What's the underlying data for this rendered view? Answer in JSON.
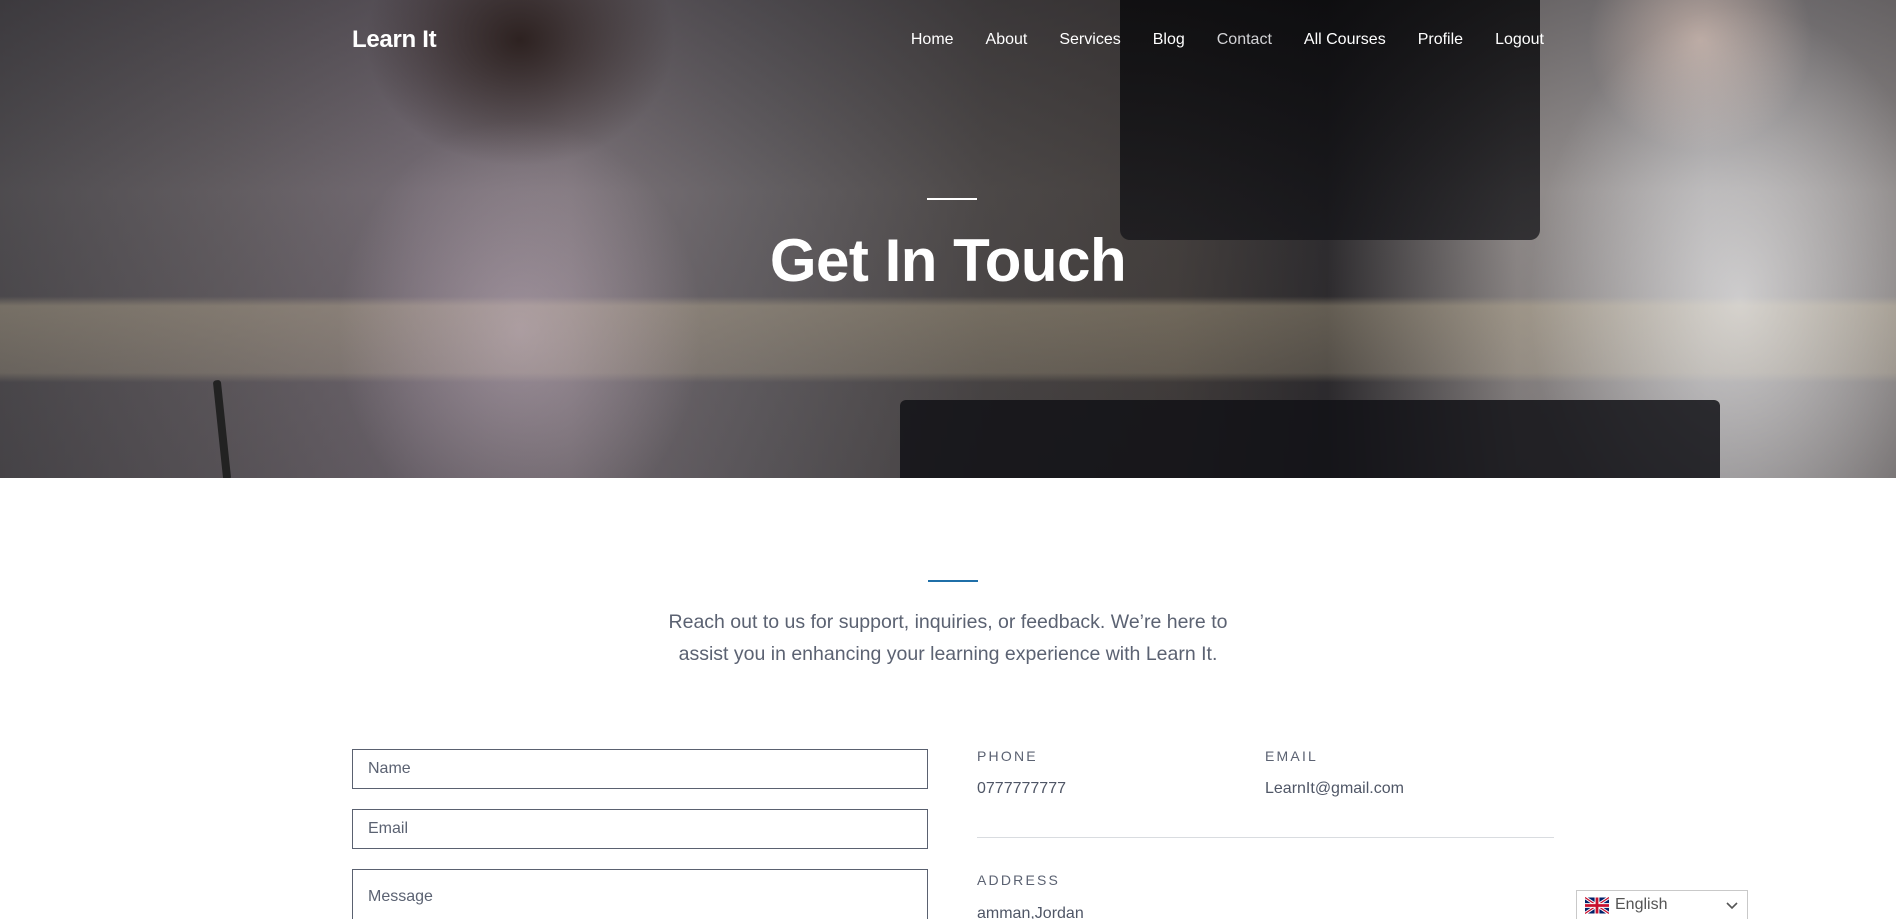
{
  "brand": {
    "name": "Learn It"
  },
  "nav": {
    "items": [
      {
        "label": "Home"
      },
      {
        "label": "About"
      },
      {
        "label": "Services"
      },
      {
        "label": "Blog"
      },
      {
        "label": "Contact"
      },
      {
        "label": "All Courses"
      },
      {
        "label": "Profile"
      },
      {
        "label": "Logout"
      }
    ],
    "active": "Contact"
  },
  "hero": {
    "title": "Get In Touch"
  },
  "intro": {
    "text": "Reach out to us for support, inquiries, or feedback. We’re here to assist you in enhancing your learning experience with Learn It."
  },
  "form": {
    "name_placeholder": "Name",
    "email_placeholder": "Email",
    "message_placeholder": "Message"
  },
  "contact_info": {
    "phone_label": "PHONE",
    "phone_value": "0777777777",
    "email_label": "EMAIL",
    "email_value": "LearnIt@gmail.com",
    "address_label": "ADDRESS",
    "address_value": "amman,Jordan"
  },
  "language": {
    "selected": "English",
    "flag_icon": "uk-flag-icon"
  },
  "colors": {
    "accent": "#1f6fa8",
    "text": "#5b6272",
    "active_nav": "#d3d3d6"
  }
}
